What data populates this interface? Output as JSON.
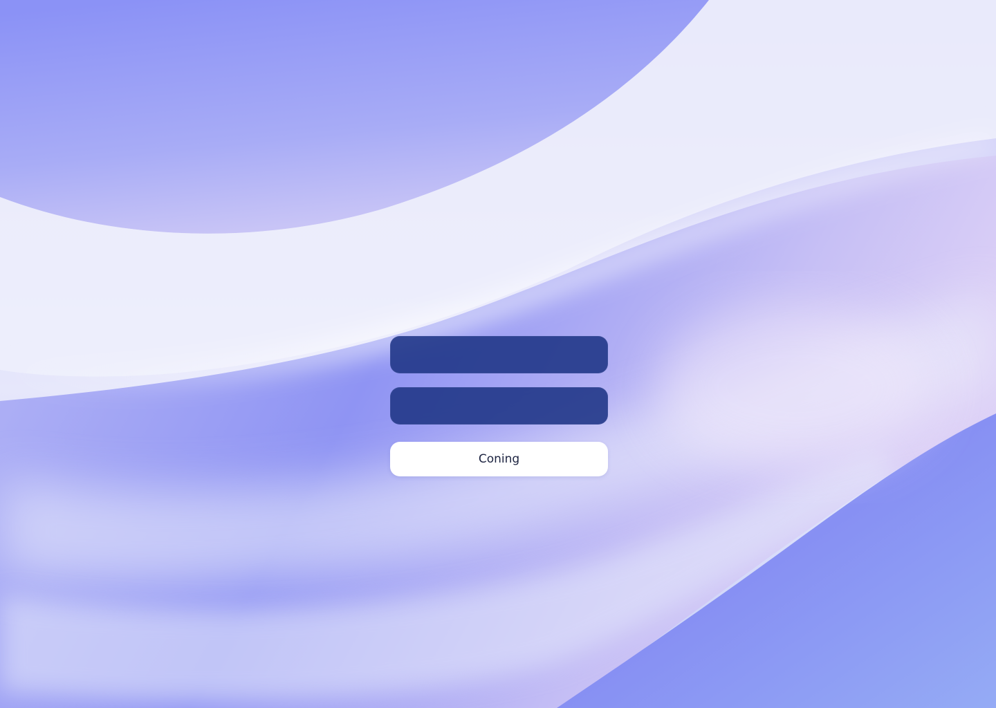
{
  "background": {
    "name": "abstract-wave-wallpaper",
    "colors": {
      "periwinkle": "#8e94f6",
      "lavender": "#c9c6f7",
      "white_highlight": "#f3f3fd",
      "blue_corner": "#92a6f6"
    }
  },
  "form": {
    "field_1": {
      "value": "",
      "placeholder": ""
    },
    "field_2": {
      "value": "",
      "placeholder": ""
    },
    "field_color": "#213788",
    "submit_label": "Coning",
    "submit_color": "#ffffff"
  }
}
